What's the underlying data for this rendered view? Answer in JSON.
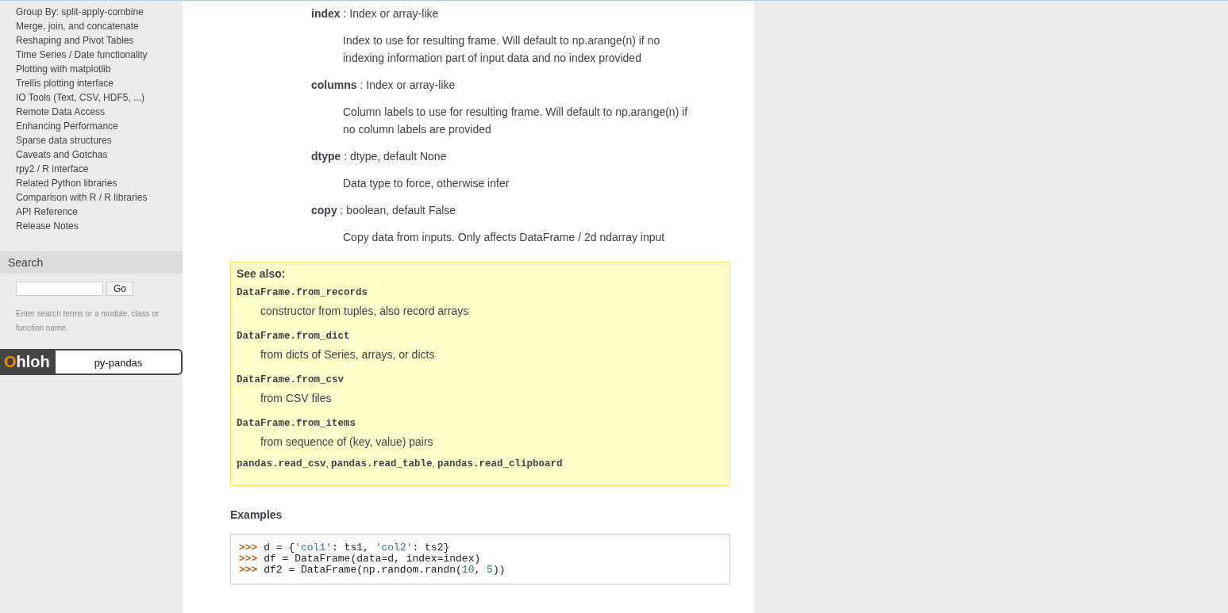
{
  "sidebar": {
    "items": [
      "Group By: split-apply-combine",
      "Merge, join, and concatenate",
      "Reshaping and Pivot Tables",
      "Time Series / Date functionality",
      "Plotting with matplotlib",
      "Trellis plotting interface",
      "IO Tools (Text, CSV, HDF5, ...)",
      "Remote Data Access",
      "Enhancing Performance",
      "Sparse data structures",
      "Caveats and Gotchas",
      "rpy2 / R interface",
      "Related Python libraries",
      "Comparison with R / R libraries",
      "API Reference",
      "Release Notes"
    ],
    "search": {
      "title": "Search",
      "button": "Go",
      "hint": "Enter search terms or a module, class or function name."
    },
    "badge": {
      "logo_first": "O",
      "logo_rest": "hloh",
      "project": "py-pandas"
    }
  },
  "parameters": [
    {
      "name": "index",
      "type": " : Index or array-like",
      "description": "Index to use for resulting frame. Will default to np.arange(n) if no indexing information part of input data and no index provided"
    },
    {
      "name": "columns",
      "type": " : Index or array-like",
      "description": "Column labels to use for resulting frame. Will default to np.arange(n) if no column labels are provided"
    },
    {
      "name": "dtype",
      "type": " : dtype, default None",
      "description": "Data type to force, otherwise infer"
    },
    {
      "name": "copy",
      "type": " : boolean, default False",
      "description": "Copy data from inputs. Only affects DataFrame / 2d ndarray input"
    }
  ],
  "see_also": {
    "title": "See also:",
    "entries": [
      {
        "name": "DataFrame.from_records",
        "description": "constructor from tuples, also record arrays"
      },
      {
        "name": "DataFrame.from_dict",
        "description": "from dicts of Series, arrays, or dicts"
      },
      {
        "name": "DataFrame.from_csv",
        "description": "from CSV files"
      },
      {
        "name": "DataFrame.from_items",
        "description": "from sequence of (key, value) pairs"
      }
    ],
    "links": [
      "pandas.read_csv",
      "pandas.read_table",
      "pandas.read_clipboard"
    ],
    "separator": ","
  },
  "examples": {
    "title": "Examples",
    "lines": [
      {
        "prompt": ">>>",
        "parts": [
          {
            "kind": "text",
            "text": " d = {"
          },
          {
            "kind": "string",
            "text": "'col1'"
          },
          {
            "kind": "text",
            "text": ": ts1, "
          },
          {
            "kind": "string",
            "text": "'col2'"
          },
          {
            "kind": "text",
            "text": ": ts2}"
          }
        ]
      },
      {
        "prompt": ">>>",
        "parts": [
          {
            "kind": "text",
            "text": " df = DataFrame(data=d, index=index)"
          }
        ]
      },
      {
        "prompt": ">>>",
        "parts": [
          {
            "kind": "text",
            "text": " df2 = DataFrame(np.random.randn("
          },
          {
            "kind": "number",
            "text": "10"
          },
          {
            "kind": "text",
            "text": ", "
          },
          {
            "kind": "number",
            "text": "5"
          },
          {
            "kind": "text",
            "text": "))"
          }
        ]
      }
    ]
  }
}
